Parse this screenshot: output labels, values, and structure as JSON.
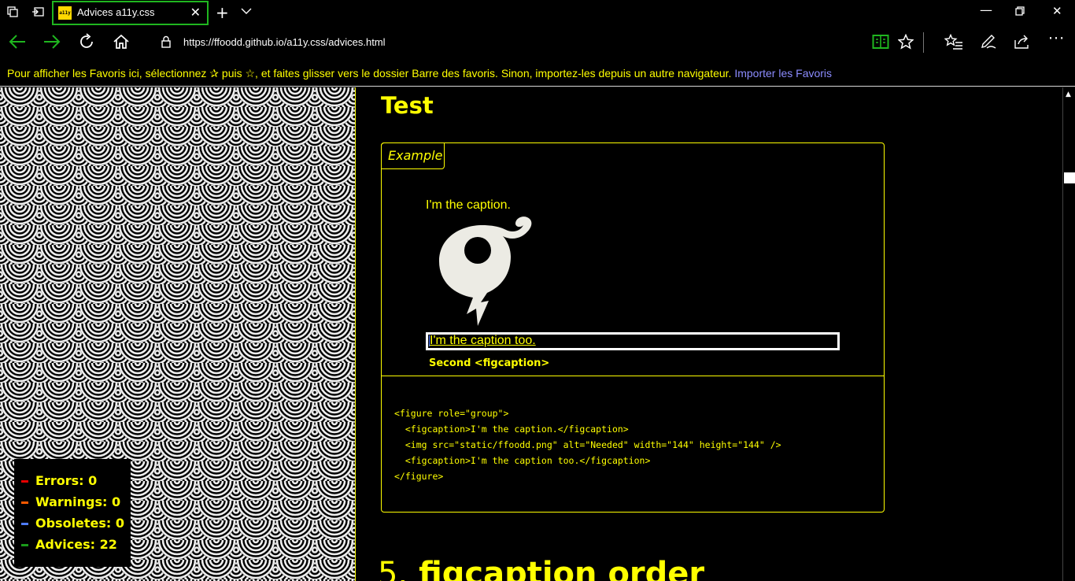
{
  "browser": {
    "tab_title": "Advices a11y.css",
    "tab_favicon_text": "a11y",
    "url": "https://ffoodd.github.io/a11y.css/advices.html",
    "favorites_bar": {
      "message": "Pour afficher les Favoris ici, sélectionnez  ✰  puis ☆, et faites glisser vers le dossier Barre des favoris. Sinon, importez-les depuis un autre navigateur.",
      "link": "Importer les Favoris"
    },
    "icons": {
      "tab_actions": "tab-actions-icon",
      "back_tabs": "set-aside-tabs-icon",
      "close_tab": "close-icon",
      "new_tab": "plus-icon",
      "tab_list": "chevron-down-icon",
      "minimize": "minimize-icon",
      "restore": "restore-icon",
      "close_window": "close-icon",
      "back": "back-arrow-icon",
      "forward": "forward-arrow-icon",
      "refresh": "refresh-icon",
      "home": "home-icon",
      "lock": "lock-icon",
      "reading_view": "reading-view-icon",
      "favorite": "star-icon",
      "favorites_hub": "favorites-list-icon",
      "notes": "pen-icon",
      "share": "share-icon",
      "more": "more-icon"
    },
    "accent_color": "#1fb61f"
  },
  "stats": {
    "errors": "Errors: 0",
    "warnings": "Warnings: 0",
    "obsoletes": "Obsoletes: 0",
    "advices": "Advices: 22",
    "colors": {
      "errors": "#e60000",
      "warnings": "#ff5a00",
      "obsoletes": "#4f7cff",
      "advices": "#1a9a1a"
    }
  },
  "content": {
    "heading": "Test",
    "example_label": "Example",
    "caption_first": "I'm the caption.",
    "caption_second": "I'm the caption too.",
    "advice_message": "Second <figcaption>",
    "code_lines": [
      "<figure role=\"group\">",
      "  <figcaption>I'm the caption.</figcaption>",
      "  <img src=\"static/ffoodd.png\" alt=\"Needed\" width=\"144\" height=\"144\" />",
      "  <figcaption>I'm the caption too.</figcaption>",
      "</figure>"
    ],
    "next_heading_number": "5.",
    "next_heading_text": "figcaption order",
    "text_color": "#ffff00"
  }
}
